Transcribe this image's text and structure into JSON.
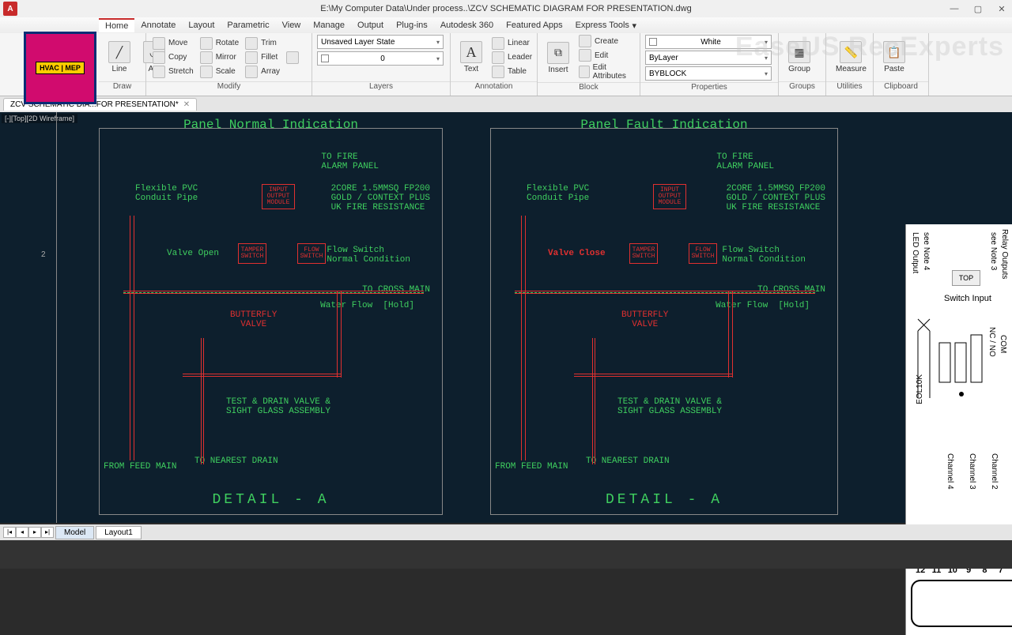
{
  "window": {
    "title": "E:\\My Computer Data\\Under process..\\ZCV SCHEMATIC DIAGRAM FOR PRESENTATION.dwg",
    "app_letter": "A"
  },
  "watermark": "EaseUS RecExperts",
  "menu": {
    "tabs": [
      "Home",
      "Annotate",
      "Layout",
      "Parametric",
      "View",
      "Manage",
      "Output",
      "Plug-ins",
      "Autodesk 360",
      "Featured Apps",
      "Express Tools"
    ],
    "active": 0
  },
  "ribbon": {
    "draw": {
      "line": "Line",
      "arc": "Arc",
      "label": "Draw"
    },
    "modify": {
      "move": "Move",
      "copy": "Copy",
      "stretch": "Stretch",
      "rotate": "Rotate",
      "mirror": "Mirror",
      "scale": "Scale",
      "trim": "Trim",
      "fillet": "Fillet",
      "array": "Array",
      "label": "Modify"
    },
    "layers": {
      "state": "Unsaved Layer State",
      "current": "0",
      "label": "Layers"
    },
    "annotation": {
      "text": "Text",
      "linear": "Linear",
      "leader": "Leader",
      "table": "Table",
      "label": "Annotation"
    },
    "block": {
      "insert": "Insert",
      "create": "Create",
      "edit": "Edit",
      "editattr": "Edit Attributes",
      "label": "Block"
    },
    "properties": {
      "color": "White",
      "line1": "ByLayer",
      "line2": "BYBLOCK",
      "label": "Properties"
    },
    "groups": {
      "group": "Group",
      "label": "Groups"
    },
    "utilities": {
      "measure": "Measure",
      "label": "Utilities"
    },
    "clipboard": {
      "paste": "Paste",
      "label": "Clipboard"
    }
  },
  "logo_text": "HVAC | MEP",
  "doc_tab": {
    "name": "ZCV SCHEMATIC DIA...FOR PRESENTATION*"
  },
  "viewport_label": "[-][Top][2D Wireframe]",
  "ruler_mark": "2",
  "left": {
    "title": "Panel Normal Indication",
    "flex": "Flexible PVC\nConduit Pipe",
    "valve_state": "Valve Open",
    "fire": "TO FIRE\nALARM PANEL",
    "cable": "2CORE 1.5MMSQ FP200\nGOLD / CONTEXT PLUS\nUK FIRE RESISTANCE",
    "flow": "Flow Switch\nNormal Condition",
    "cross": "TO CROSS MAIN",
    "water": "Water Flow  [Hold]",
    "butterfly": "BUTTERFLY\nVALVE",
    "test": "TEST & DRAIN VALVE &\nSIGHT GLASS ASSEMBLY",
    "drain": "TO NEAREST DRAIN",
    "feed": "FROM FEED MAIN",
    "detail": "DETAIL - A",
    "io_module": "INPUT OUTPUT\nMODULE",
    "tamper": "TAMPER\nSWITCH",
    "flowsw": "FLOW\nSWITCH"
  },
  "right": {
    "title": "Panel Fault Indication",
    "valve_state": "Valve Close"
  },
  "side": {
    "cube": "TOP",
    "led": "LED Output",
    "note4": "see Note 4",
    "switch": "Switch\nInput",
    "note3": "see Note 3",
    "relay": "Relay Outputs",
    "nc": "NC / NO",
    "com": "COM",
    "eol": "EOL10K",
    "ch4": "Channel 4",
    "ch3": "Channel 3",
    "ch2": "Channel 2",
    "terminals": [
      "12",
      "11",
      "10",
      "9",
      "8",
      "7"
    ]
  },
  "bottom": {
    "model": "Model",
    "layout1": "Layout1"
  }
}
